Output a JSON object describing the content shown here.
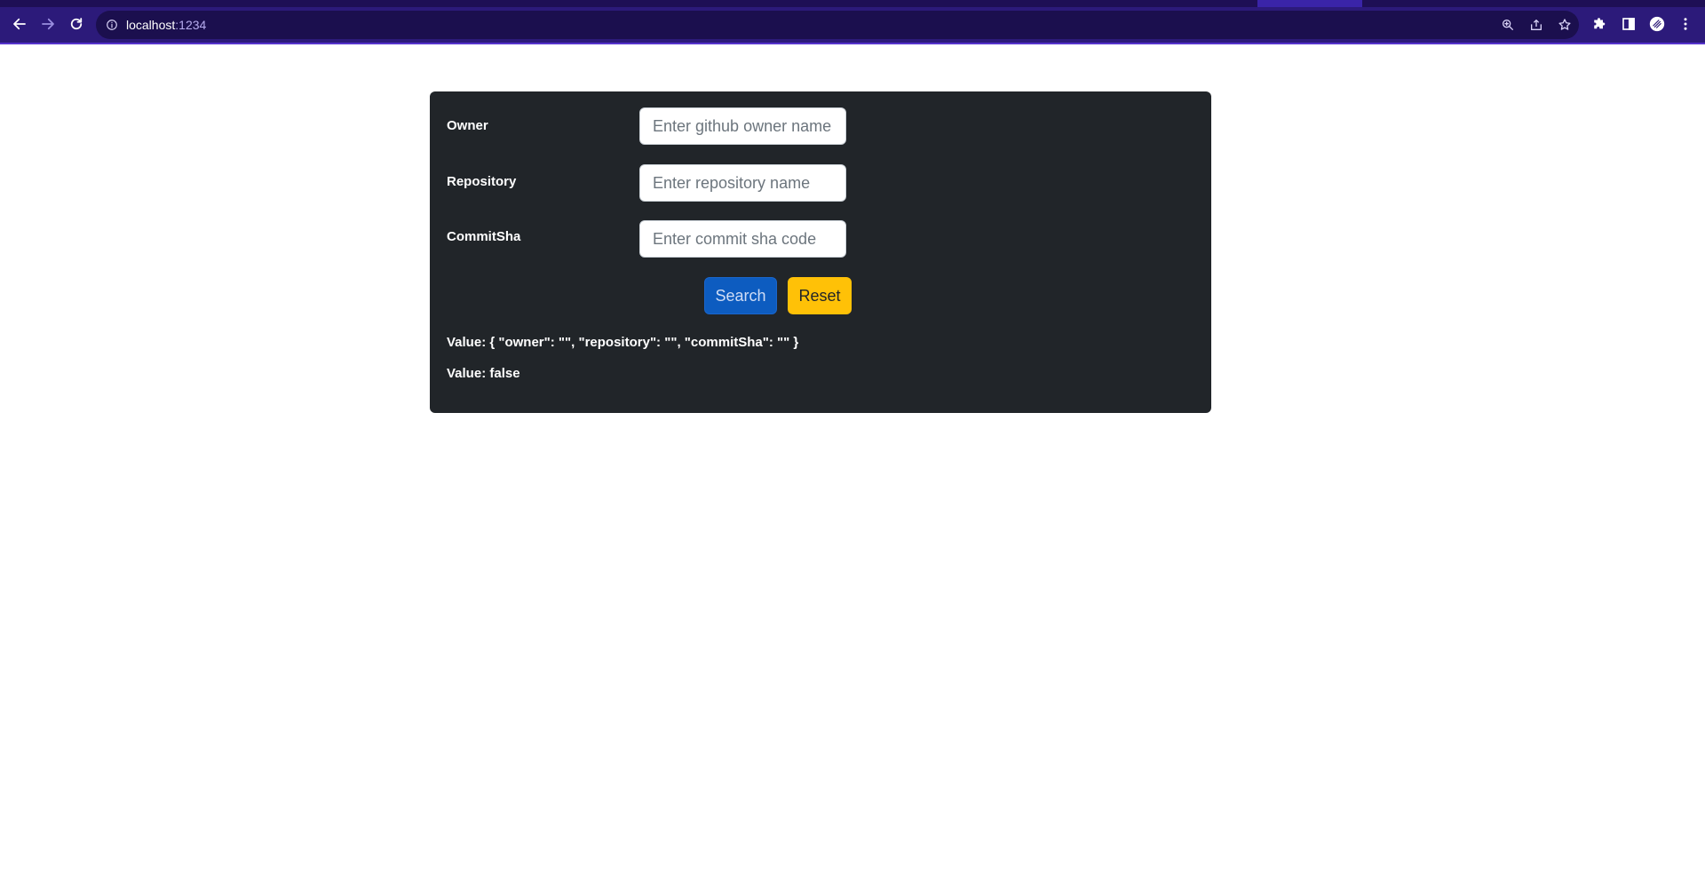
{
  "browser": {
    "url_host": "localhost",
    "url_port": ":1234"
  },
  "form": {
    "owner_label": "Owner",
    "owner_placeholder": "Enter github owner name",
    "owner_value": "",
    "repository_label": "Repository",
    "repository_placeholder": "Enter repository name",
    "repository_value": "",
    "commitsha_label": "CommitSha",
    "commitsha_placeholder": "Enter commit sha code",
    "commitsha_value": "",
    "search_label": "Search",
    "reset_label": "Reset"
  },
  "output": {
    "value_json": "Value: { \"owner\": \"\", \"repository\": \"\", \"commitSha\": \"\" }",
    "value_bool": "Value: false"
  },
  "colors": {
    "chrome_bg": "#2c1a7a",
    "card_bg": "#212529",
    "search_button": "#0d5cc0",
    "reset_button": "#ffc107"
  },
  "icons": {
    "back": "back-arrow-icon",
    "forward": "forward-arrow-icon",
    "reload": "reload-icon",
    "site_info": "info-icon",
    "zoom": "zoom-icon",
    "share": "share-icon",
    "bookmark": "star-icon",
    "extensions": "puzzle-icon",
    "side_panel": "side-panel-icon",
    "profile": "profile-avatar-icon",
    "menu": "kebab-menu-icon"
  }
}
